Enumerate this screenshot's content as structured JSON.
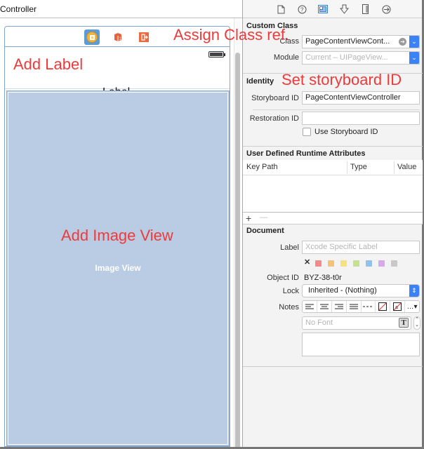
{
  "canvas": {
    "title": "Controller",
    "scene": {
      "dock_icons": [
        "view-controller-icon",
        "first-responder-icon",
        "exit-icon"
      ],
      "label_text": "Label",
      "image_view_text": "Image View"
    }
  },
  "annotations": {
    "assign_class": "Assign Class ref.",
    "add_label": "Add Label",
    "set_storyboard_id": "Set storyboard ID",
    "add_image_view": "Add Image View"
  },
  "inspector": {
    "tabs": [
      {
        "name": "file-inspector",
        "glyph": "🗋"
      },
      {
        "name": "quick-help",
        "glyph": "?"
      },
      {
        "name": "identity-inspector",
        "glyph": "▤",
        "active": true
      },
      {
        "name": "attributes-inspector",
        "glyph": "⇩"
      },
      {
        "name": "size-inspector",
        "glyph": "▯"
      },
      {
        "name": "connections-inspector",
        "glyph": "→"
      }
    ],
    "custom_class": {
      "title": "Custom Class",
      "class_label": "Class",
      "class_value": "PageContentViewCont...",
      "module_label": "Module",
      "module_placeholder": "Current – UIPageView..."
    },
    "identity": {
      "title": "Identity",
      "storyboard_id_label": "Storyboard ID",
      "storyboard_id_value": "PageContentViewController",
      "restoration_id_label": "Restoration ID",
      "restoration_id_value": "",
      "use_storyboard_id_label": "Use Storyboard ID",
      "use_storyboard_id_checked": false
    },
    "runtime_attributes": {
      "title": "User Defined Runtime Attributes",
      "columns": [
        "Key Path",
        "Type",
        "Value"
      ],
      "rows": [],
      "add_label": "+",
      "remove_label": "—"
    },
    "document": {
      "title": "Document",
      "label_label": "Label",
      "label_placeholder": "Xcode Specific Label",
      "clear_color_glyph": "✕",
      "label_colors": [
        "#f28b8b",
        "#f5c27a",
        "#f7e07e",
        "#c5e08e",
        "#8fc3ef",
        "#d5a9ea",
        "#c8c8c8"
      ],
      "object_id_label": "Object ID",
      "object_id_value": "BYZ-38-t0r",
      "lock_label": "Lock",
      "lock_value": "Inherited - (Nothing)",
      "notes_label": "Notes",
      "notes_toolbar": [
        "≡",
        "≡",
        "≡",
        "≡",
        "---",
        "⧄",
        "⧄",
        "...▾"
      ],
      "font_placeholder": "No Font",
      "notes_text": ""
    }
  },
  "colors": {
    "accent": "#3b82f6",
    "annotation": "#ee3a3a",
    "image_view_bg": "#bacce3"
  }
}
